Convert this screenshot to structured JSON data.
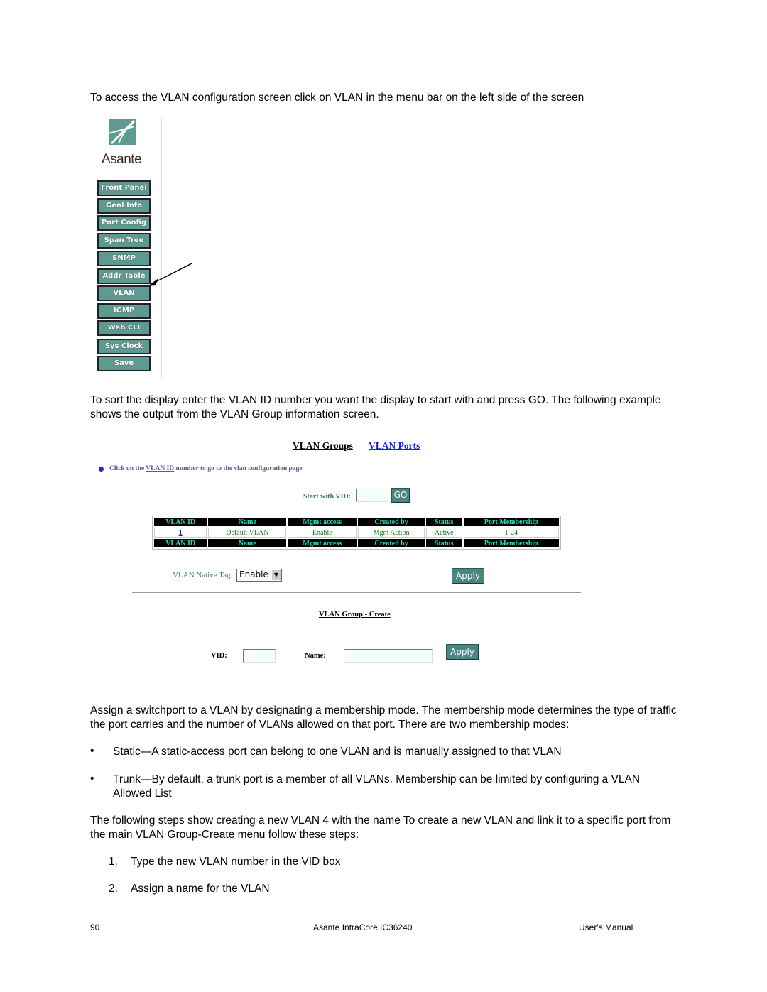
{
  "intro": "To access the VLAN configuration screen click on VLAN in the menu bar on the left side of the screen",
  "logo": {
    "text": "Asante"
  },
  "nav": [
    "Front Panel",
    "Genl Info",
    "Port Config",
    "Span Tree",
    "SNMP",
    "Addr Table",
    "VLAN",
    "IGMP",
    "Web CLI",
    "Sys Clock",
    "Save"
  ],
  "sort_text": "To sort the display enter the VLAN ID number you want the display to start with and press GO. The following example shows the output from the VLAN Group information screen.",
  "screen": {
    "tabs": [
      "VLAN Groups",
      "VLAN Ports"
    ],
    "hint": {
      "pre": "Click on the ",
      "link": "VLAN ID",
      "post": " number to go to the vlan configuration page"
    },
    "start_label": "Start with VID:",
    "start_value": "",
    "go": "GO",
    "table": {
      "headers": [
        "VLAN ID",
        "Name",
        "Mgmt access",
        "Created by",
        "Status",
        "Port Membership"
      ],
      "rows": [
        [
          "1",
          "Default VLAN",
          "Enable",
          "Mgm Action",
          "Active",
          "1-24"
        ]
      ]
    },
    "native_tag_label": "VLAN Native Tag:",
    "native_tag_value": "Enable",
    "apply": "Apply",
    "create_title": "VLAN Group - Create",
    "vid_label": "VID:",
    "name_label": "Name:",
    "vid_value": "",
    "name_value": "",
    "create_apply": "Apply"
  },
  "assign_text": "Assign a switchport to a VLAN by designating a membership mode. The membership mode determines the type of traffic the port carries and the number of VLANs allowed on that port. There are two membership modes:",
  "bullets": [
    "Static—A static-access port can belong to one VLAN and is manually assigned to that VLAN",
    "Trunk—By default, a trunk port is a member of all VLANs. Membership can be limited by configuring a VLAN Allowed List"
  ],
  "steps_text": "The following steps show creating a new VLAN 4 with the name To create a new VLAN and link it to a specific port from the main VLAN Group-Create menu follow these steps:",
  "steps": [
    {
      "n": "1.",
      "t": "Type the new VLAN number in the VID box"
    },
    {
      "n": "2.",
      "t": "Assign a name for the VLAN"
    }
  ],
  "footer": {
    "page": "90",
    "product": "Asante IntraCore IC36240",
    "manual": "User's Manual"
  }
}
